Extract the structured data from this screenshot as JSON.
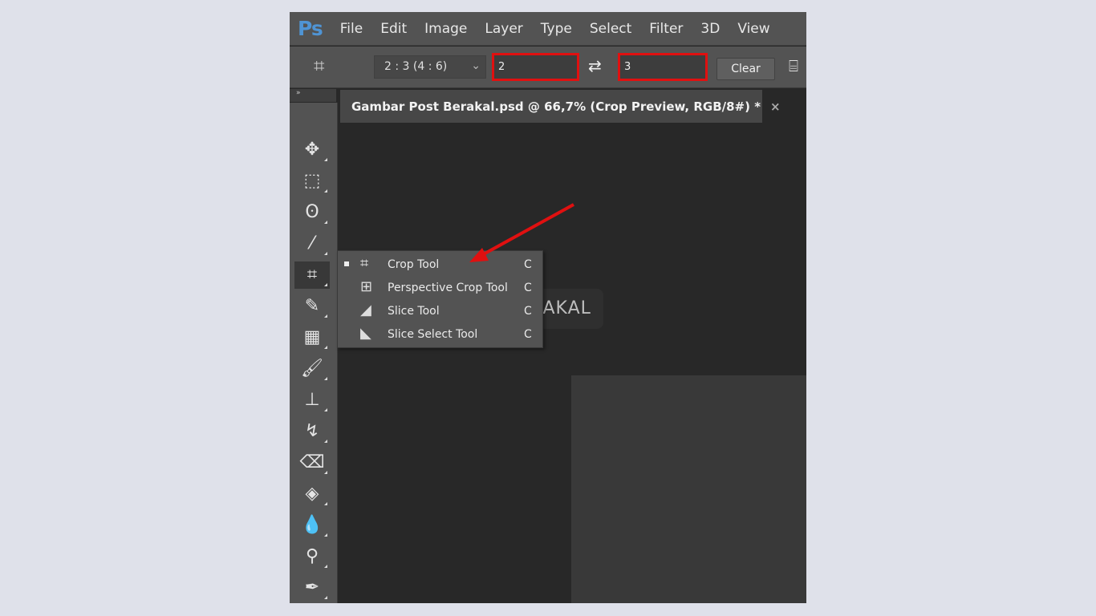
{
  "app": {
    "logo": "Ps"
  },
  "menu": [
    "File",
    "Edit",
    "Image",
    "Layer",
    "Type",
    "Select",
    "Filter",
    "3D",
    "View"
  ],
  "options": {
    "tool_icon": "crop-icon",
    "ratio": "2 : 3 (4 : 6)",
    "width": "2",
    "height": "3",
    "clear": "Clear",
    "highlight_color": "#e01010"
  },
  "panel_toggle": "»",
  "document_tab": {
    "title": "Gambar Post Berakal.psd @ 66,7% (Crop Preview, RGB/8#) *",
    "close": "×"
  },
  "tools": [
    {
      "name": "move-tool",
      "glyph": "✥"
    },
    {
      "name": "marquee-tool",
      "glyph": "⬚"
    },
    {
      "name": "lasso-tool",
      "glyph": "ʘ"
    },
    {
      "name": "magic-wand-tool",
      "glyph": "⁄"
    },
    {
      "name": "crop-tool",
      "glyph": "⌗",
      "selected": true
    },
    {
      "name": "eyedropper-tool",
      "glyph": "✎"
    },
    {
      "name": "healing-brush-tool",
      "glyph": "▦"
    },
    {
      "name": "brush-tool",
      "glyph": "🖌"
    },
    {
      "name": "stamp-tool",
      "glyph": "⊥"
    },
    {
      "name": "history-brush-tool",
      "glyph": "↯"
    },
    {
      "name": "eraser-tool",
      "glyph": "⌫"
    },
    {
      "name": "paint-bucket-tool",
      "glyph": "◈"
    },
    {
      "name": "blur-tool",
      "glyph": "💧"
    },
    {
      "name": "dodge-tool",
      "glyph": "⚲"
    },
    {
      "name": "pen-tool",
      "glyph": "✒"
    }
  ],
  "flyout": [
    {
      "label": "Crop Tool",
      "shortcut": "C",
      "icon": "crop-icon",
      "glyph": "⌗",
      "active": true
    },
    {
      "label": "Perspective Crop Tool",
      "shortcut": "C",
      "icon": "perspective-crop-icon",
      "glyph": "⊞"
    },
    {
      "label": "Slice Tool",
      "shortcut": "C",
      "icon": "slice-icon",
      "glyph": "◢"
    },
    {
      "label": "Slice Select Tool",
      "shortcut": "C",
      "icon": "slice-select-icon",
      "glyph": "◣"
    }
  ],
  "watermark": "BERAKAL",
  "annotation_color": "#e01010"
}
